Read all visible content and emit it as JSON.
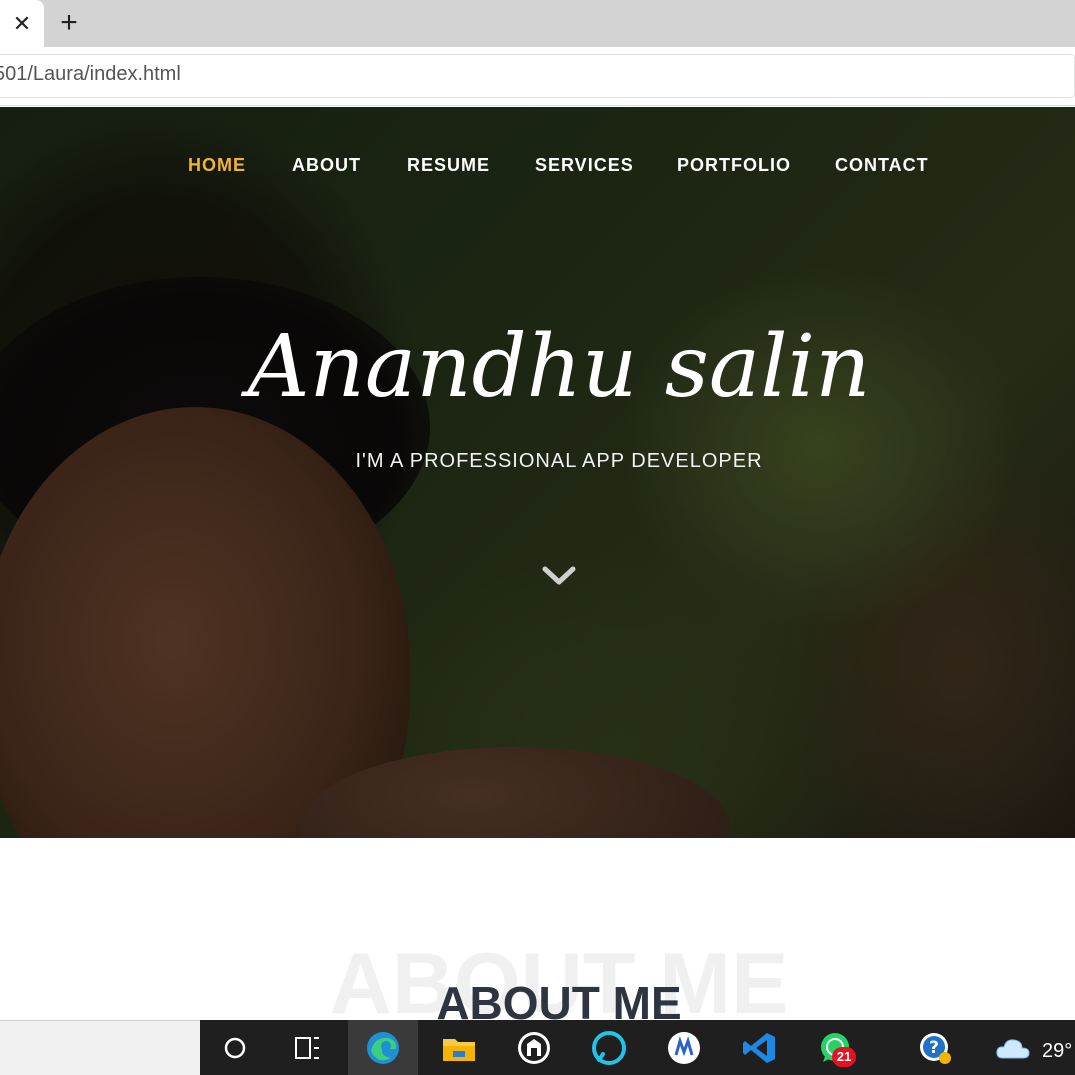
{
  "browser": {
    "tab_close_glyph": "✕",
    "new_tab_glyph": "+",
    "address": "501/Laura/index.html"
  },
  "nav": {
    "items": [
      {
        "label": "HOME",
        "active": true
      },
      {
        "label": "ABOUT",
        "active": false
      },
      {
        "label": "RESUME",
        "active": false
      },
      {
        "label": "SERVICES",
        "active": false
      },
      {
        "label": "PORTFOLIO",
        "active": false
      },
      {
        "label": "CONTACT",
        "active": false
      }
    ],
    "active_color": "#f0b435"
  },
  "hero": {
    "title": "Anandhu salin",
    "subtitle": "I'M A PROFESSIONAL APP DEVELOPER",
    "scroll_icon": "chevron-down-icon"
  },
  "about": {
    "background_text": "ABOUT ME",
    "title": "ABOUT ME"
  },
  "taskbar": {
    "icons": [
      "cortana-icon",
      "task-view-icon",
      "edge-icon",
      "file-explorer-icon",
      "app-icon",
      "alexa-icon",
      "app-icon",
      "vscode-icon",
      "whatsapp-icon",
      "help-icon",
      "weather-icon"
    ],
    "whatsapp_badge": "21",
    "temperature": "29°"
  }
}
